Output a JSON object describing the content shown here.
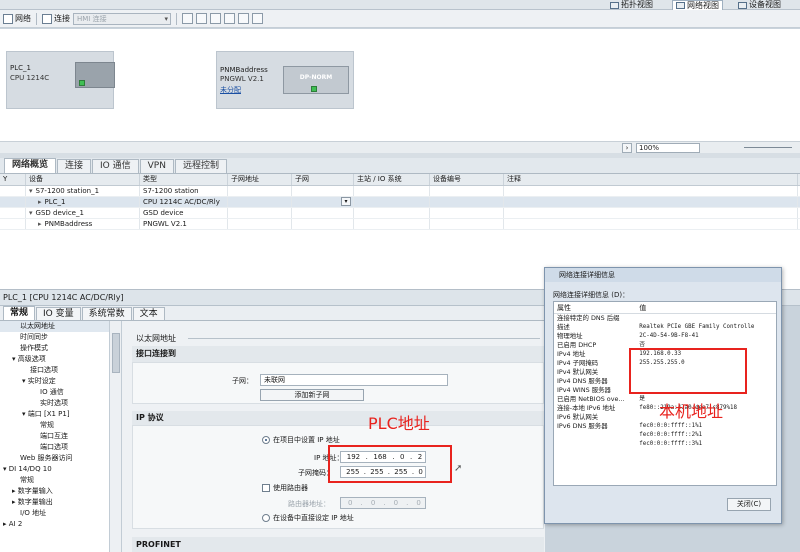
{
  "view_switch": {
    "topology": "拓扑视图",
    "network": "网络视图",
    "device": "设备视图"
  },
  "toolbar": {
    "network_label": "网络",
    "connect_label": "连接",
    "connection_select": "HMI 连接"
  },
  "canvas": {
    "plc": {
      "name": "PLC_1",
      "type": "CPU 1214C"
    },
    "gsd": {
      "name": "PNMBaddress",
      "type": "PNGWL V2.1",
      "link": "未分配",
      "module_label": "DP-NORM"
    },
    "zoom": "100%"
  },
  "network_tabs": [
    "网络概览",
    "连接",
    "IO 通信",
    "VPN",
    "远程控制"
  ],
  "overview": {
    "headers": [
      "设备",
      "类型",
      "子网地址",
      "子网",
      "主站 / IO 系统",
      "设备编号",
      "注释"
    ],
    "rows": [
      {
        "device": "S7-1200 station_1",
        "type": "S7-1200 station"
      },
      {
        "device": "PLC_1",
        "type": "CPU 1214C AC/DC/Rly"
      },
      {
        "device": "GSD device_1",
        "type": "GSD device"
      },
      {
        "device": "PNMBaddress",
        "type": "PNGWL V2.1"
      }
    ]
  },
  "properties": {
    "title": "PLC_1 [CPU 1214C AC/DC/Rly]",
    "tabs": [
      "常规",
      "IO 变量",
      "系统常数",
      "文本"
    ],
    "tree": [
      "以太网地址",
      "时间同步",
      "操作模式",
      "▾ 高级选项",
      "接口选项",
      "▾ 实时设定",
      "IO 通信",
      "实时选项",
      "▾ 端口 [X1 P1]",
      "常规",
      "端口互连",
      "端口选项",
      "Web 服务器访问",
      "▾ DI 14/DQ 10",
      "常规",
      "▸ 数字量输入",
      "▸ 数字量输出",
      "I/O 地址",
      "▸ AI 2"
    ]
  },
  "ethernet": {
    "header": "以太网地址",
    "interface_section": "接口连接到",
    "subnet_label": "子网：",
    "subnet_value": "未联网",
    "add_subnet": "添加新子网",
    "ip_section": "IP 协议",
    "opt_project": "在项目中设置 IP 地址",
    "ip_label": "IP 地址：",
    "ip": [
      "192",
      "168",
      "0",
      "2"
    ],
    "mask_label": "子网掩码：",
    "mask": [
      "255",
      "255",
      "255",
      "0"
    ],
    "use_router": "使用路由器",
    "router_label": "路由器地址：",
    "router": [
      "0",
      "0",
      "0",
      "0"
    ],
    "opt_device": "在设备中直接设定 IP 地址",
    "profinet": "PROFINET"
  },
  "dialog": {
    "title": "网络连接详细信息",
    "caption": "网络连接详细信息 (D)：",
    "col_prop": "属性",
    "col_val": "值",
    "rows": [
      {
        "p": "连接特定的 DNS 后缀",
        "v": ""
      },
      {
        "p": "描述",
        "v": "Realtek PCIe GBE Family Controlle"
      },
      {
        "p": "物理地址",
        "v": "2C-4D-54-9B-F8-41"
      },
      {
        "p": "已启用 DHCP",
        "v": "否"
      },
      {
        "p": "IPv4 地址",
        "v": "192.168.0.33"
      },
      {
        "p": "IPv4 子网掩码",
        "v": "255.255.255.0"
      },
      {
        "p": "IPv4 默认网关",
        "v": ""
      },
      {
        "p": "IPv4 DNS 服务器",
        "v": ""
      },
      {
        "p": "IPv4 WINS 服务器",
        "v": ""
      },
      {
        "p": "已启用 NetBIOS ove...",
        "v": "是"
      },
      {
        "p": "连接-本地 IPv6 地址",
        "v": "fe80::219a:47a0:dee7:c879%18"
      },
      {
        "p": "IPv6 默认网关",
        "v": ""
      },
      {
        "p": "IPv6 DNS 服务器",
        "v": "fec0:0:0:ffff::1%1"
      },
      {
        "p": "",
        "v": "fec0:0:0:ffff::2%1"
      },
      {
        "p": "",
        "v": "fec0:0:0:ffff::3%1"
      }
    ],
    "close": "关闭(C)"
  },
  "annotations": {
    "plc": "PLC地址",
    "local": "本机地址"
  }
}
